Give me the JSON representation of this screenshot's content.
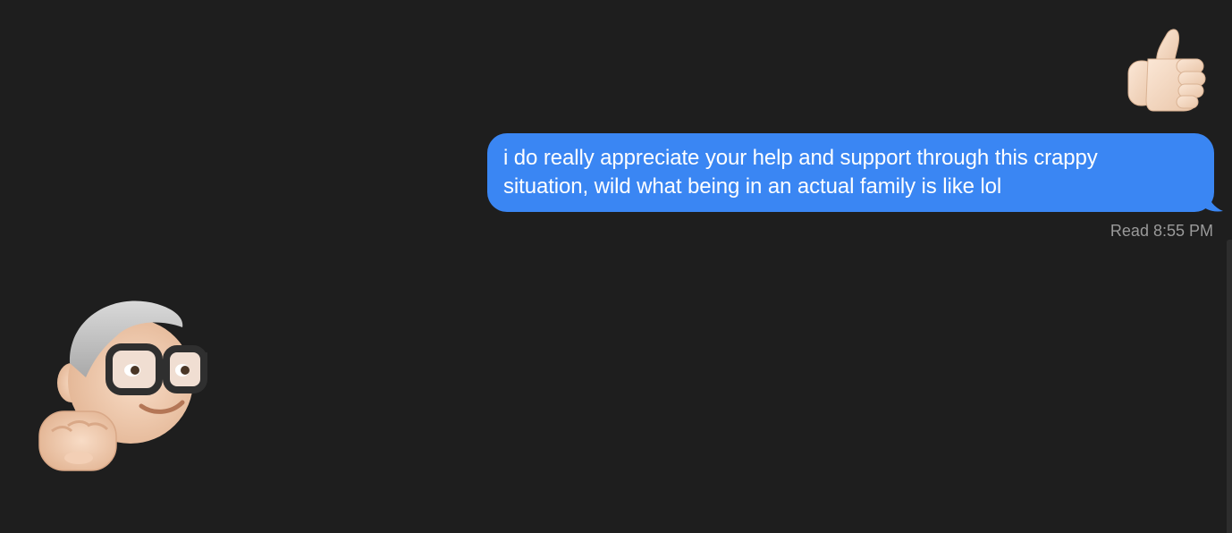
{
  "conversation": {
    "outgoing_message": {
      "line1": "i do really appreciate your help and support through this crappy",
      "line2": "situation, wild what being in an actual family is like lol",
      "bubble_color": "#3a86f3"
    },
    "read_receipt": "Read 8:55 PM",
    "stickers": {
      "outgoing": "thumbs-up-icon",
      "incoming": "memoji-fist-bump-icon"
    }
  },
  "colors": {
    "background": "#1e1e1e",
    "receipt_text": "#9a9a9a",
    "skin": "#f4d9c3"
  }
}
